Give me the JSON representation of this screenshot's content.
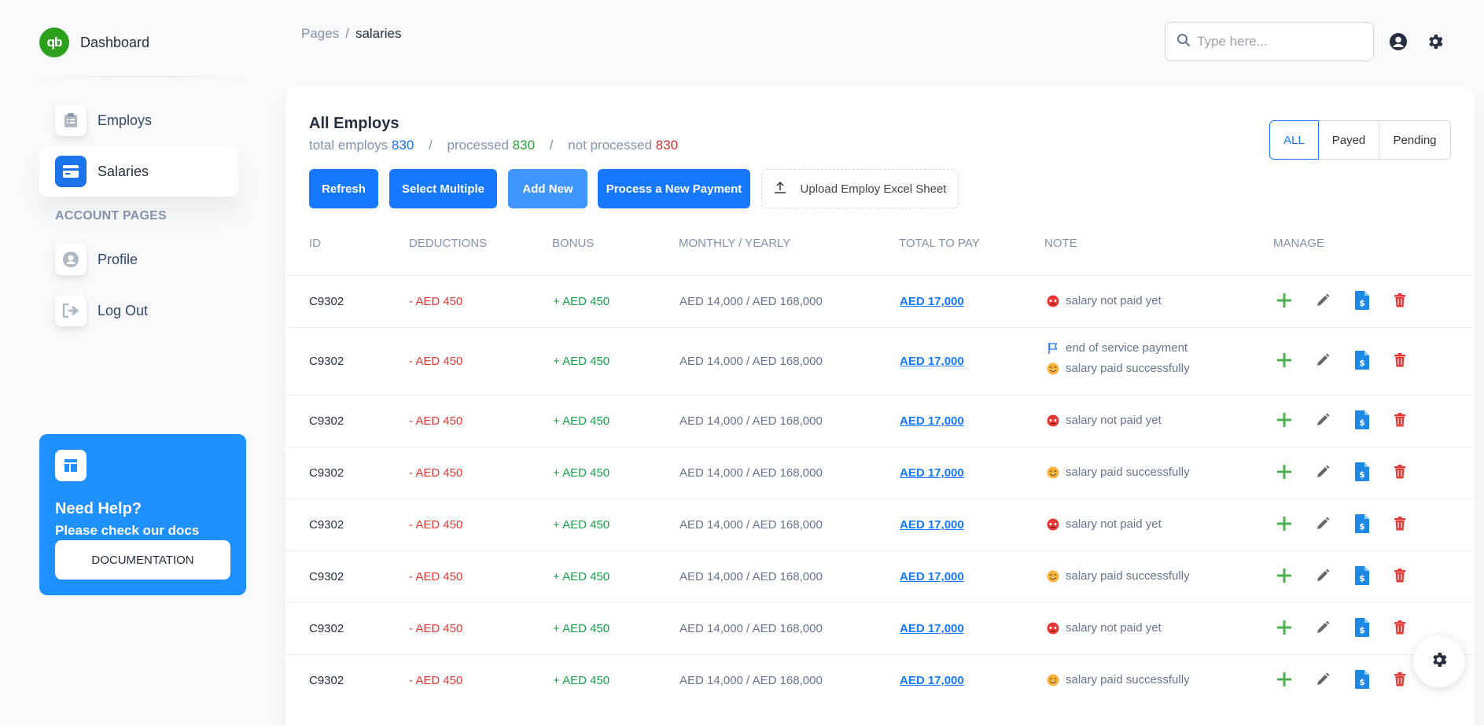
{
  "brand": {
    "name": "Dashboard",
    "logo_text": "qb"
  },
  "sidebar": {
    "items": [
      {
        "label": "Employs",
        "icon": "clipboard-icon",
        "active": false
      },
      {
        "label": "Salaries",
        "icon": "credit-card-icon",
        "active": true
      }
    ],
    "section_label": "ACCOUNT PAGES",
    "account_items": [
      {
        "label": "Profile",
        "icon": "user-circle-icon"
      },
      {
        "label": "Log Out",
        "icon": "logout-icon"
      }
    ],
    "help": {
      "title": "Need Help?",
      "subtitle": "Please check our docs",
      "button": "DOCUMENTATION"
    }
  },
  "header": {
    "breadcrumb": {
      "root": "Pages",
      "separator": "/",
      "current": "salaries"
    },
    "search_placeholder": "Type here..."
  },
  "main": {
    "title": "All Employs",
    "stats": {
      "total_label": "total employs",
      "total": "830",
      "processed_label": "processed",
      "processed": "830",
      "not_processed_label": "not processed",
      "not_processed": "830",
      "separator": "/"
    },
    "buttons": {
      "refresh": "Refresh",
      "select_multiple": "Select Multiple",
      "add_new": "Add New",
      "process_payment": "Process a New Payment",
      "upload": "Upload Employ Excel Sheet"
    },
    "filters": [
      "ALL",
      "Payed",
      "Pending"
    ],
    "active_filter": "ALL",
    "table": {
      "headers": [
        "ID",
        "DEDUCTIONS",
        "BONUS",
        "MONTHLY / YEARLY",
        "TOTAL TO PAY",
        "NOTE",
        "MANAGE"
      ],
      "rows": [
        {
          "id": "C9302",
          "deductions": "- AED 450",
          "bonus": "+ AED 450",
          "monthly_yearly": "AED 14,000 / AED 168,000",
          "total": "AED 17,000",
          "notes": [
            {
              "icon": "red-face-icon",
              "text": "salary not paid yet"
            }
          ]
        },
        {
          "id": "C9302",
          "deductions": "- AED 450",
          "bonus": "+ AED 450",
          "monthly_yearly": "AED 14,000 / AED 168,000",
          "total": "AED 17,000",
          "notes": [
            {
              "icon": "flag-icon",
              "text": "end of service payment"
            },
            {
              "icon": "smile-icon",
              "text": "salary paid successfully"
            }
          ]
        },
        {
          "id": "C9302",
          "deductions": "- AED 450",
          "bonus": "+ AED 450",
          "monthly_yearly": "AED 14,000 / AED 168,000",
          "total": "AED 17,000",
          "notes": [
            {
              "icon": "red-face-icon",
              "text": "salary not paid yet"
            }
          ]
        },
        {
          "id": "C9302",
          "deductions": "- AED 450",
          "bonus": "+ AED 450",
          "monthly_yearly": "AED 14,000 / AED 168,000",
          "total": "AED 17,000",
          "notes": [
            {
              "icon": "smile-icon",
              "text": "salary paid successfully"
            }
          ]
        },
        {
          "id": "C9302",
          "deductions": "- AED 450",
          "bonus": "+ AED 450",
          "monthly_yearly": "AED 14,000 / AED 168,000",
          "total": "AED 17,000",
          "notes": [
            {
              "icon": "red-face-icon",
              "text": "salary not paid yet"
            }
          ]
        },
        {
          "id": "C9302",
          "deductions": "- AED 450",
          "bonus": "+ AED 450",
          "monthly_yearly": "AED 14,000 / AED 168,000",
          "total": "AED 17,000",
          "notes": [
            {
              "icon": "smile-icon",
              "text": "salary paid successfully"
            }
          ]
        },
        {
          "id": "C9302",
          "deductions": "- AED 450",
          "bonus": "+ AED 450",
          "monthly_yearly": "AED 14,000 / AED 168,000",
          "total": "AED 17,000",
          "notes": [
            {
              "icon": "red-face-icon",
              "text": "salary not paid yet"
            }
          ]
        },
        {
          "id": "C9302",
          "deductions": "- AED 450",
          "bonus": "+ AED 450",
          "monthly_yearly": "AED 14,000 / AED 168,000",
          "total": "AED 17,000",
          "notes": [
            {
              "icon": "smile-icon",
              "text": "salary paid successfully"
            }
          ]
        }
      ],
      "actions": [
        "plus-icon",
        "pencil-icon",
        "invoice-icon",
        "trash-icon"
      ]
    }
  },
  "colors": {
    "accent": "#1677ff",
    "sidebar_active": "#1a73e8",
    "help_card": "#1e90ff",
    "brand": "#2ca01c",
    "negative": "#e53935",
    "positive": "#16a34a"
  }
}
